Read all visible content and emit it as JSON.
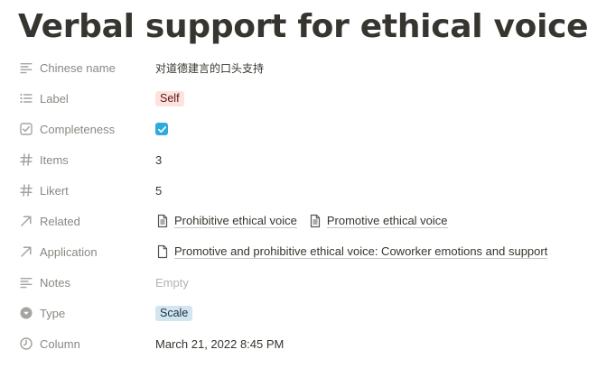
{
  "page": {
    "title": "Verbal support for ethical voice"
  },
  "properties": {
    "chinese_name": {
      "label": "Chinese name",
      "icon": "text-lines-icon",
      "value": "对道德建言的口头支持"
    },
    "label": {
      "label": "Label",
      "icon": "list-icon",
      "tag": "Self",
      "tag_color": "#fde2dd"
    },
    "completeness": {
      "label": "Completeness",
      "icon": "checkbox-icon",
      "checked": true,
      "check_color": "#2eaadc"
    },
    "items": {
      "label": "Items",
      "icon": "hash-icon",
      "value": "3"
    },
    "likert": {
      "label": "Likert",
      "icon": "hash-icon",
      "value": "5"
    },
    "related": {
      "label": "Related",
      "icon": "relation-arrow-icon",
      "links": [
        "Prohibitive ethical voice",
        "Promotive ethical voice"
      ]
    },
    "application": {
      "label": "Application",
      "icon": "relation-arrow-icon",
      "links": [
        "Promotive and prohibitive ethical voice: Coworker emotions and support"
      ]
    },
    "notes": {
      "label": "Notes",
      "icon": "text-lines-icon",
      "value": "Empty"
    },
    "type": {
      "label": "Type",
      "icon": "select-circle-icon",
      "tag": "Scale",
      "tag_color": "#d3e5ef"
    },
    "column": {
      "label": "Column",
      "icon": "clock-icon",
      "value": "March 21, 2022 8:45 PM"
    }
  }
}
